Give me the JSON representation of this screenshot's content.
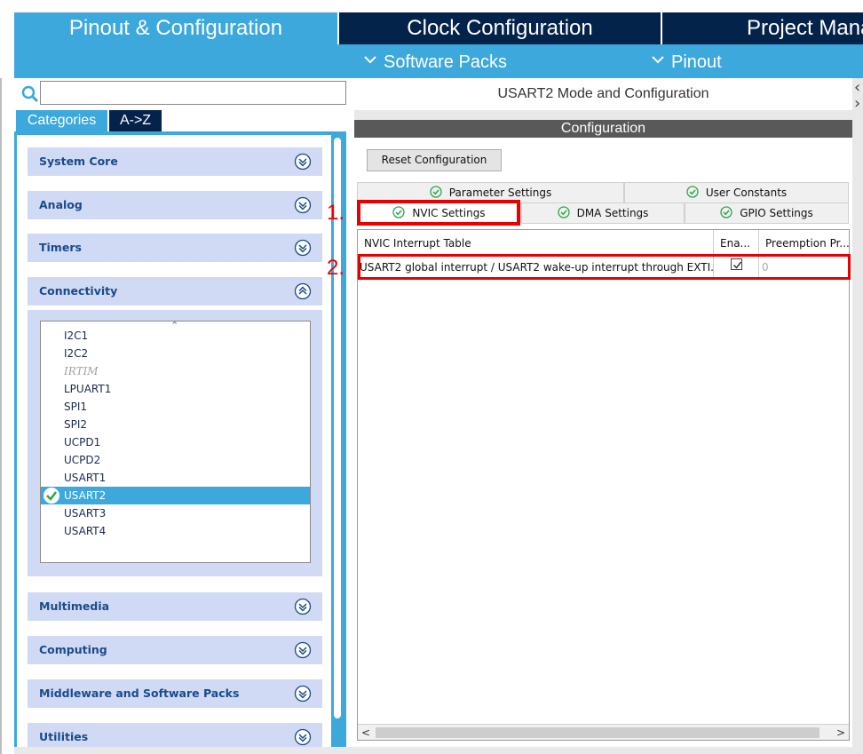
{
  "colors": {
    "accent": "#3ca8dc",
    "dark_tab": "#03234b",
    "category_header": "#d1daf4",
    "highlight": "#e80000",
    "check_green": "#2aa84a"
  },
  "top_tabs": [
    {
      "label": "Pinout & Configuration",
      "active": true
    },
    {
      "label": "Clock Configuration",
      "active": false
    },
    {
      "label": "Project Mana",
      "active": false
    }
  ],
  "sub_menu": {
    "software_packs": "Software Packs",
    "pinout": "Pinout",
    "icon": "chevron-down-icon"
  },
  "left": {
    "search": {
      "value": "",
      "placeholder": "",
      "icon": "search-icon"
    },
    "tabs": {
      "categories": "Categories",
      "az": "A->Z"
    },
    "categories": [
      {
        "label": "System Core",
        "expanded": false
      },
      {
        "label": "Analog",
        "expanded": false
      },
      {
        "label": "Timers",
        "expanded": false
      },
      {
        "label": "Connectivity",
        "expanded": true
      },
      {
        "label": "Multimedia",
        "expanded": false
      },
      {
        "label": "Computing",
        "expanded": false
      },
      {
        "label": "Middleware and Software Packs",
        "expanded": false
      },
      {
        "label": "Utilities",
        "expanded": false
      }
    ],
    "connectivity_items": [
      {
        "label": "I2C1",
        "state": "normal"
      },
      {
        "label": "I2C2",
        "state": "normal"
      },
      {
        "label": "IRTIM",
        "state": "disabled"
      },
      {
        "label": "LPUART1",
        "state": "normal"
      },
      {
        "label": "SPI1",
        "state": "normal"
      },
      {
        "label": "SPI2",
        "state": "normal"
      },
      {
        "label": "UCPD1",
        "state": "normal"
      },
      {
        "label": "UCPD2",
        "state": "normal"
      },
      {
        "label": "USART1",
        "state": "normal"
      },
      {
        "label": "USART2",
        "state": "selected"
      },
      {
        "label": "USART3",
        "state": "normal"
      },
      {
        "label": "USART4",
        "state": "normal"
      }
    ]
  },
  "right": {
    "mode_title": "USART2 Mode and Configuration",
    "config_header": "Configuration",
    "reset_button": "Reset Configuration",
    "tabs": {
      "parameter": "Parameter Settings",
      "user_constants": "User Constants",
      "nvic": "NVIC Settings",
      "dma": "DMA Settings",
      "gpio": "GPIO Settings"
    },
    "annotations": {
      "marker1": "1.",
      "marker2": "2."
    },
    "table": {
      "headers": [
        "NVIC Interrupt Table",
        "Ena...",
        "Preemption Pr..."
      ],
      "rows": [
        {
          "name": "USART2 global interrupt / USART2 wake-up interrupt through EXTI...",
          "enabled": true,
          "preemption": "0"
        }
      ]
    },
    "scroll": {
      "left": "<",
      "right": ">"
    }
  }
}
